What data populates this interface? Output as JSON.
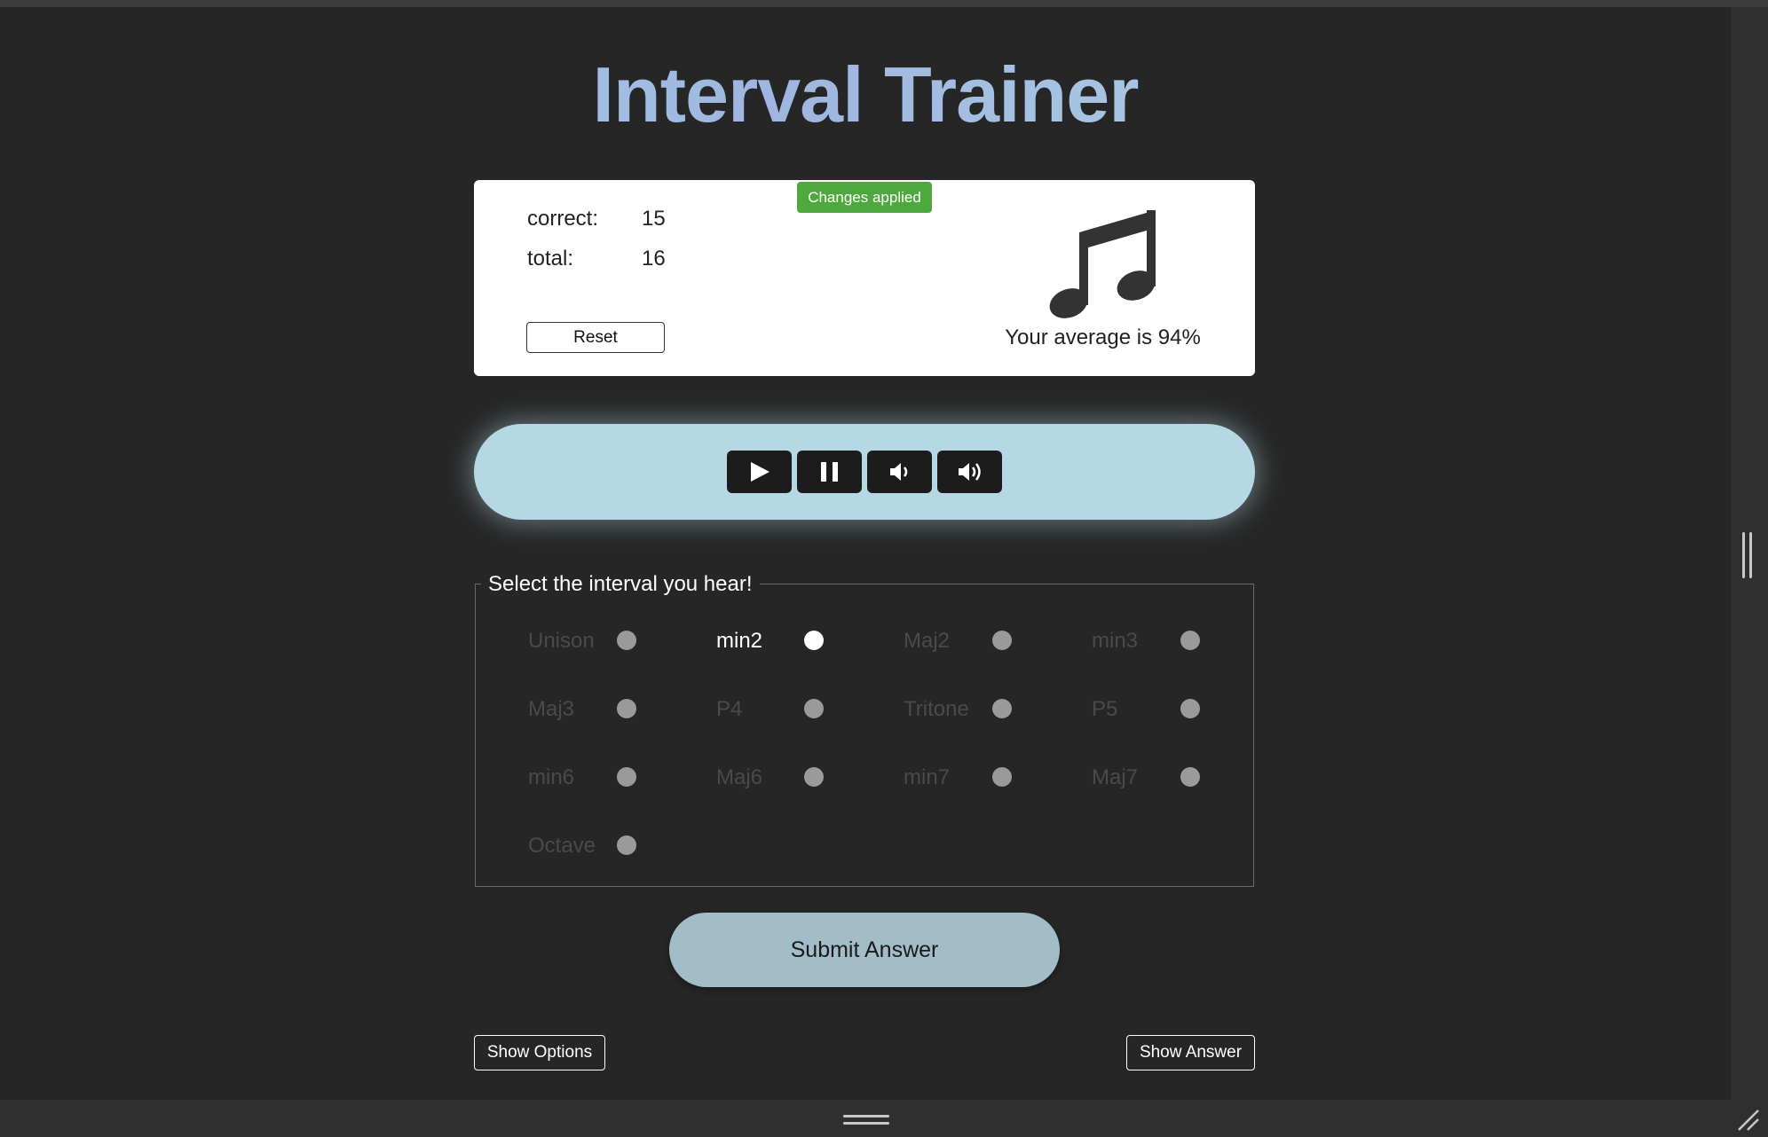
{
  "app": {
    "title": "Interval Trainer"
  },
  "notification": {
    "text": "Changes applied",
    "color": "#4fa83d"
  },
  "stats": {
    "correct_label": "correct:",
    "correct_value": "15",
    "total_label": "total:",
    "total_value": "16",
    "reset_label": "Reset",
    "average_text": "Your average is 94%",
    "icon": "music-note-icon"
  },
  "player": {
    "background": "#b5d8e4",
    "buttons": [
      {
        "icon": "play-icon"
      },
      {
        "icon": "pause-icon"
      },
      {
        "icon": "volume-down-icon"
      },
      {
        "icon": "volume-up-icon"
      }
    ]
  },
  "question": {
    "legend": "Select the interval you hear!",
    "selected": "min2",
    "options": [
      {
        "label": "Unison"
      },
      {
        "label": "min2"
      },
      {
        "label": "Maj2"
      },
      {
        "label": "min3"
      },
      {
        "label": "Maj3"
      },
      {
        "label": "P4"
      },
      {
        "label": "Tritone"
      },
      {
        "label": "P5"
      },
      {
        "label": "min6"
      },
      {
        "label": "Maj6"
      },
      {
        "label": "min7"
      },
      {
        "label": "Maj7"
      },
      {
        "label": "Octave"
      }
    ]
  },
  "actions": {
    "submit_label": "Submit Answer",
    "show_options_label": "Show Options",
    "show_answer_label": "Show Answer"
  }
}
